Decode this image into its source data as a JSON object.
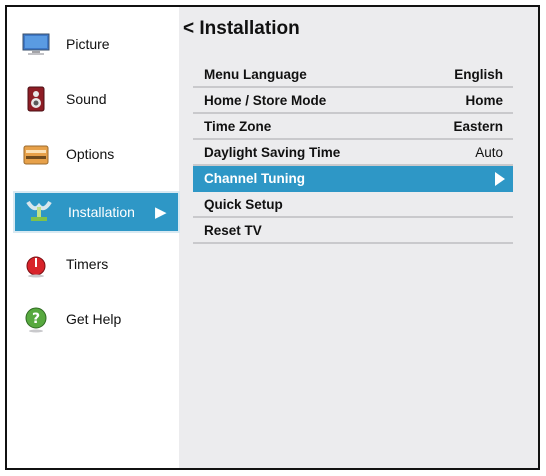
{
  "sidebar": {
    "items": [
      {
        "label": "Picture",
        "icon": "tv-monitor-icon"
      },
      {
        "label": "Sound",
        "icon": "speaker-icon"
      },
      {
        "label": "Options",
        "icon": "options-panel-icon"
      },
      {
        "label": "Installation",
        "icon": "satellite-dish-icon",
        "selected": true
      },
      {
        "label": "Timers",
        "icon": "power-clock-icon"
      },
      {
        "label": "Get Help",
        "icon": "help-question-icon"
      }
    ]
  },
  "main": {
    "back_symbol": "<",
    "title": "Installation",
    "rows": [
      {
        "name": "Menu Language",
        "value": "English"
      },
      {
        "name": "Home / Store Mode",
        "value": "Home"
      },
      {
        "name": "Time Zone",
        "value": "Eastern"
      },
      {
        "name": "Daylight Saving Time",
        "value": "Auto"
      },
      {
        "name": "Channel Tuning",
        "value": "",
        "selected": true
      },
      {
        "name": "Quick Setup",
        "value": ""
      },
      {
        "name": "Reset TV",
        "value": ""
      }
    ]
  },
  "colors": {
    "accent": "#2e97c6",
    "panel_background": "#ececee",
    "divider": "#c9c9cc"
  }
}
